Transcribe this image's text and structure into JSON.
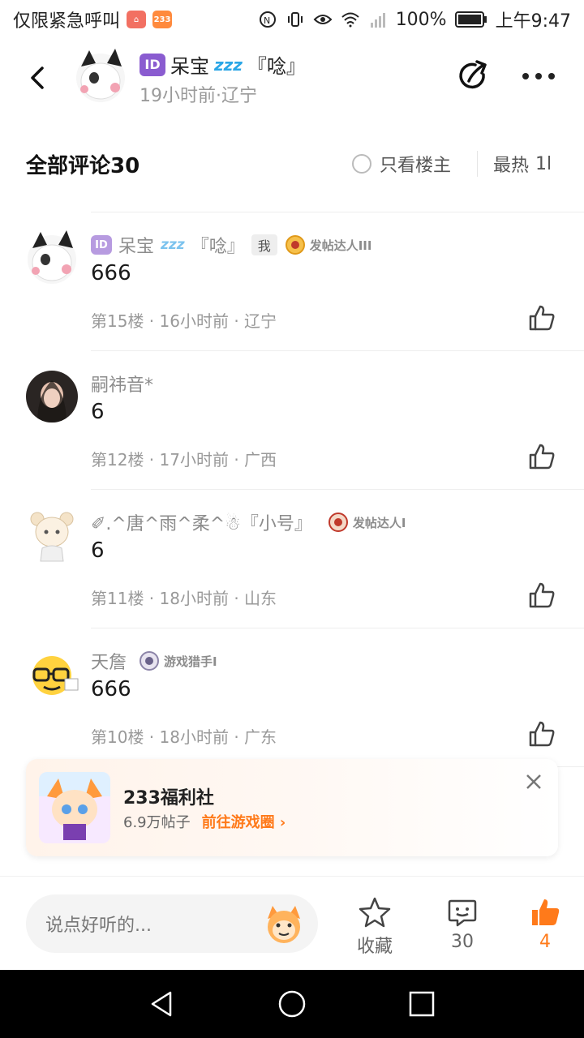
{
  "status": {
    "emergency_text": "仅限紧急呼叫",
    "badge_233": "233",
    "battery": "100%",
    "time": "上午9:47"
  },
  "header": {
    "id_badge": "ID",
    "author_name": "呆宝",
    "zzz": "zzz",
    "author_suffix": "『唸』",
    "subtitle": "19小时前·辽宁"
  },
  "comments_bar": {
    "title": "全部评论30",
    "owner_only": "只看楼主",
    "sort": "最热",
    "sort_icon": "1l"
  },
  "comments": [
    {
      "id_badge": "ID",
      "name": "呆宝",
      "zzz": "zzz",
      "name_suffix": "『唸』",
      "me_tag": "我",
      "medal": "发帖达人III",
      "text": "666",
      "meta": "第15楼 · 16小时前 · 辽宁"
    },
    {
      "name": "嗣祎音*",
      "text": "6",
      "meta": "第12楼 · 17小时前 · 广西"
    },
    {
      "name": "✐.^唐^雨^柔^☃『小号』",
      "medal": "发帖达人I",
      "text": "6",
      "meta": "第11楼 · 18小时前 · 山东"
    },
    {
      "name": "天詹",
      "medal": "游戏猎手I",
      "text": "666",
      "meta": "第10楼 · 18小时前 · 广东"
    }
  ],
  "banner": {
    "title": "233福利社",
    "posts": "6.9万帖子",
    "link": "前往游戏圈 ›"
  },
  "bottom": {
    "input_placeholder": "说点好听的...",
    "favorite_label": "收藏",
    "comment_count": "30",
    "like_count": "4"
  },
  "colors": {
    "accent": "#ff7a1a",
    "id_badge": "#8a5cd0",
    "muted_text": "#999999"
  }
}
